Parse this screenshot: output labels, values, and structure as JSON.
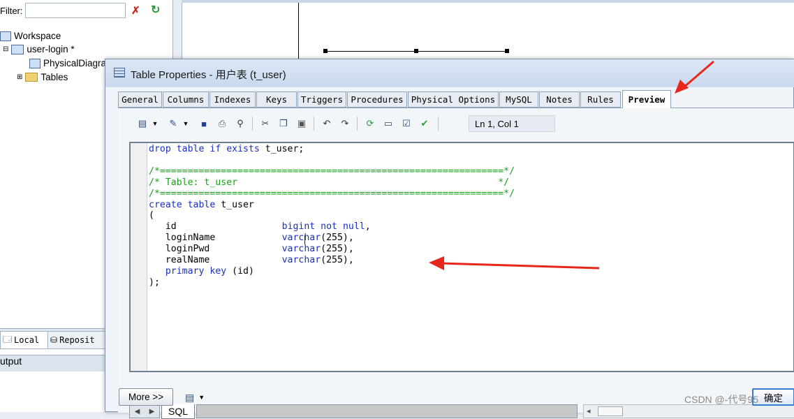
{
  "left_panel": {
    "filter_label": "Filter:",
    "filter_value": "",
    "tree": {
      "workspace": "Workspace",
      "model": "user-login *",
      "diagram": "PhysicalDiagra",
      "tables": "Tables"
    },
    "bottom_tabs": {
      "local": "Local",
      "repository": "Reposit"
    },
    "output_label": "utput"
  },
  "dialog": {
    "title": "Table Properties - 用户表 (t_user)",
    "tabs": [
      "General",
      "Columns",
      "Indexes",
      "Keys",
      "Triggers",
      "Procedures",
      "Physical Options",
      "MySQL",
      "Notes",
      "Rules",
      "Preview"
    ],
    "active_tab": "Preview",
    "toolbar": {
      "status": "Ln 1, Col 1",
      "icons": [
        "sql-script-icon",
        "dropdown-icon",
        "edit-icon",
        "dropdown-icon",
        "save-icon",
        "print-icon",
        "find-icon",
        "cut-icon",
        "copy-icon",
        "paste-icon",
        "undo-icon",
        "redo-icon",
        "refresh-icon",
        "preview-icon",
        "edit-preview-icon",
        "check-icon"
      ]
    },
    "code_lines": [
      {
        "t": "drop table if exists t_user;",
        "k": "mixed"
      },
      {
        "t": "",
        "k": "plain"
      },
      {
        "t": "/*==============================================================*/",
        "k": "comment"
      },
      {
        "t": "/* Table: t_user                                               */",
        "k": "comment"
      },
      {
        "t": "/*==============================================================*/",
        "k": "comment"
      },
      {
        "t": "create table t_user",
        "k": "mixed"
      },
      {
        "t": "(",
        "k": "plain"
      },
      {
        "t": "   id                   bigint not null,",
        "k": "mixed"
      },
      {
        "t": "   loginName            varchar(255),",
        "k": "mixed"
      },
      {
        "t": "   loginPwd             varchar(255),",
        "k": "mixed"
      },
      {
        "t": "   realName             varchar(255),",
        "k": "mixed"
      },
      {
        "t": "   primary key (id)",
        "k": "mixed"
      },
      {
        "t": ");",
        "k": "plain"
      }
    ],
    "editor_tab": "SQL",
    "more_button": "More >>",
    "ok_button": "确定"
  },
  "watermark": "CSDN @-代号95",
  "colors": {
    "keyword": "#1a30c0",
    "comment": "#1aa01a",
    "arrow": "#e8271b",
    "active_tab_bg": "#ffffff"
  }
}
